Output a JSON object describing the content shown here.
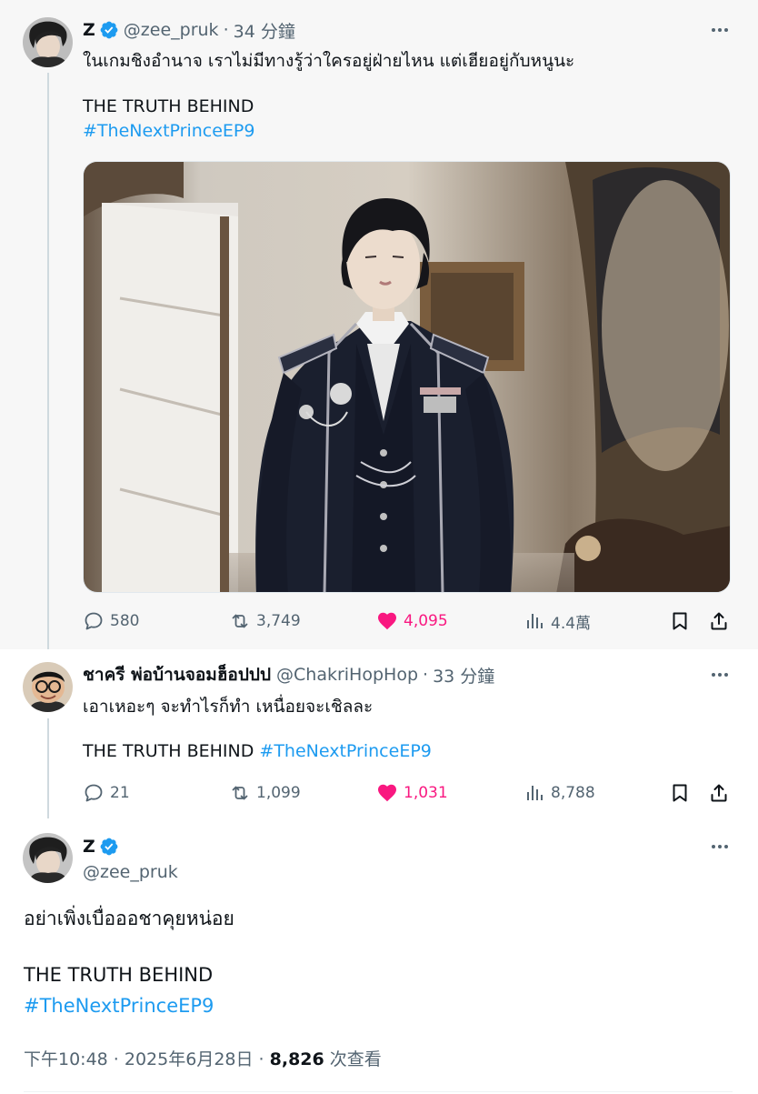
{
  "colors": {
    "accent": "#1d9bf0",
    "like": "#f91880",
    "muted": "#536471",
    "text": "#0f1419",
    "thread_bg": "#f7f7f7"
  },
  "tweet1": {
    "name": "Z",
    "handle": "@zee_pruk",
    "time": "34 分鐘",
    "line1": "ในเกมชิงอำนาจ เราไม่มีทางรู้ว่าใครอยู่ฝ่ายไหน แต่เฮียอยู่กับหนูนะ",
    "line2": "THE TRUTH BEHIND",
    "hashtag": "#TheNextPrinceEP9",
    "stats": {
      "replies": "580",
      "reposts": "3,749",
      "likes": "4,095",
      "views": "4.4萬"
    }
  },
  "tweet2": {
    "name": "ชาครี พ่อบ้านจอมฮ็อปปป",
    "handle": "@ChakriHopHop",
    "time": "33 分鐘",
    "line1": "เอาเหอะๆ จะทำไรก็ทำ เหนื่อยจะเชิลละ",
    "line2": "THE TRUTH BEHIND ",
    "hashtag": "#TheNextPrinceEP9",
    "stats": {
      "replies": "21",
      "reposts": "1,099",
      "likes": "1,031",
      "views": "8,788"
    }
  },
  "tweet3": {
    "name": "Z",
    "handle": "@zee_pruk",
    "line1": "อย่าเพิ่งเบื่อออชาคุยหน่อย",
    "line2": "THE TRUTH BEHIND",
    "hashtag": "#TheNextPrinceEP9",
    "time_date": "下午10:48 · 2025年6月28日 · ",
    "views_count": "8,826",
    "views_label": " 次查看"
  },
  "icons": {
    "verified": "verified-badge-icon",
    "more": "more-icon",
    "reply": "reply-icon",
    "repost": "repost-icon",
    "like": "heart-icon",
    "views": "views-icon",
    "bookmark": "bookmark-icon",
    "share": "share-icon"
  }
}
